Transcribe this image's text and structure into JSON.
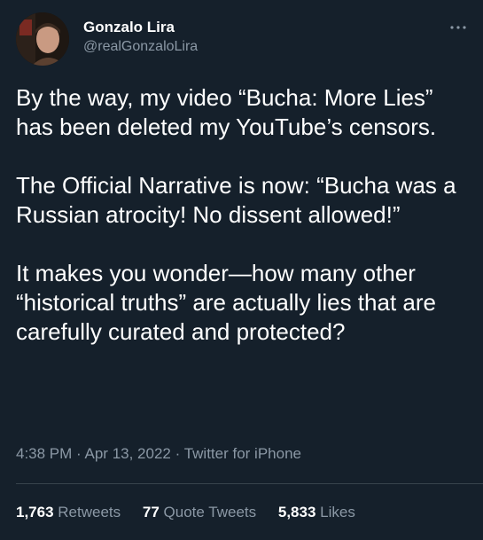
{
  "author": {
    "display_name": "Gonzalo Lira",
    "handle": "@realGonzaloLira"
  },
  "tweet": {
    "paragraphs": [
      "By the way, my video “Bucha: More Lies” has been deleted my YouTube’s censors.",
      "The Official Narrative is now: “Bucha was a Russian atrocity! No dissent allowed!”",
      "It makes you wonder—how many other “historical truths” are actually lies that are carefully curated and protected?"
    ],
    "time": "4:38 PM",
    "date": "Apr 13, 2022",
    "source": "Twitter for iPhone",
    "separator": "·"
  },
  "stats": {
    "retweets": {
      "count": "1,763",
      "label": "Retweets"
    },
    "quote_tweets": {
      "count": "77",
      "label": "Quote Tweets"
    },
    "likes": {
      "count": "5,833",
      "label": "Likes"
    }
  },
  "icons": {
    "more": "more-icon"
  },
  "colors": {
    "background": "#15202b",
    "primary_text": "#ffffff",
    "secondary_text": "#8b98a5",
    "divider": "#38444d"
  }
}
